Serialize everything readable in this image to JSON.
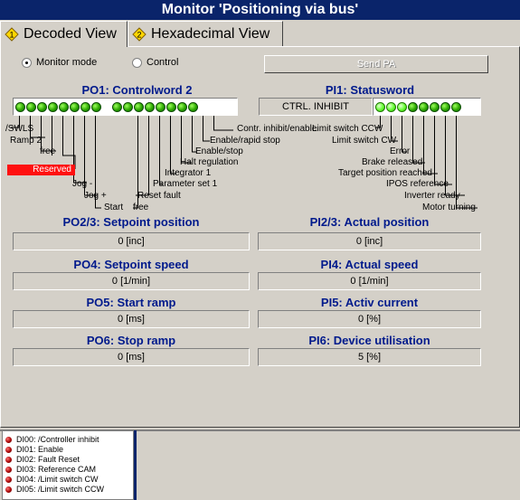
{
  "window": {
    "title": "Monitor 'Positioning via bus'"
  },
  "tabs": [
    {
      "label": "Decoded View",
      "icon": "decoded-view-icon",
      "active": true
    },
    {
      "label": "Hexadecimal View",
      "icon": "hexadecimal-view-icon",
      "active": false
    }
  ],
  "mode": {
    "monitor_label": "Monitor mode",
    "control_label": "Control",
    "selected": "Monitor mode",
    "send_pa_label": "Send PA"
  },
  "po1": {
    "title": "PO1: Controlword 2",
    "led_states": [
      1,
      1,
      1,
      1,
      1,
      1,
      1,
      1,
      1,
      1,
      1,
      1,
      1,
      1,
      1,
      1
    ],
    "bit_labels": {
      "swls": "/SWLS",
      "ramp2": "Ramp 2",
      "free1": "free",
      "reserved": "Reserved",
      "jog_minus": "Jog -",
      "jog_plus": "Jog +",
      "start": "Start",
      "free2": "free",
      "reset_fault": "Reset fault",
      "integrator1": "Integrator 1",
      "param_set1": "Parameter set 1",
      "halt_regulation": "Halt regulation",
      "enable_stop": "Enable/stop",
      "enable_rapid_stop": "Enable/rapid stop",
      "contr_inhibit_enable": "Contr. inhibit/enable"
    }
  },
  "pi1": {
    "title": "PI1: Statusword",
    "state_text": "CTRL. INHIBIT",
    "led_states": [
      1,
      1,
      1,
      1,
      1,
      1,
      1,
      1
    ],
    "bit_labels": {
      "limit_ccw": "Limit switch CCW",
      "limit_cw": "Limit switch CW",
      "error": "Error",
      "brake_released": "Brake released",
      "target_reached": "Target position reached",
      "ipos_reference": "IPOS reference",
      "inverter_ready": "Inverter ready",
      "motor_turning": "Motor turning"
    }
  },
  "values": {
    "po23": {
      "title": "PO2/3: Setpoint position",
      "value": "0 [inc]"
    },
    "pi23": {
      "title": "PI2/3: Actual position",
      "value": "0 [inc]"
    },
    "po4": {
      "title": "PO4: Setpoint speed",
      "value": "0 [1/min]"
    },
    "pi4": {
      "title": "PI4: Actual speed",
      "value": "0 [1/min]"
    },
    "po5": {
      "title": "PO5: Start ramp",
      "value": "0 [ms]"
    },
    "pi5": {
      "title": "PI5: Activ current",
      "value": "0 [%]"
    },
    "po6": {
      "title": "PO6: Stop ramp",
      "value": "0 [ms]"
    },
    "pi6": {
      "title": "PI6: Device utilisation",
      "value": "5 [%]"
    }
  },
  "digital_inputs": [
    "DI00: /Controller inhibit",
    "DI01: Enable",
    "DI02: Fault Reset",
    "DI03: Reference CAM",
    "DI04: /Limit switch CW",
    "DI05: /Limit switch CCW"
  ],
  "colors": {
    "title_bar": "#0a246a",
    "header_text": "#001a8c",
    "reserved_bg": "#ff1010",
    "led_on": "#2ca800",
    "di_led": "#a00000"
  }
}
